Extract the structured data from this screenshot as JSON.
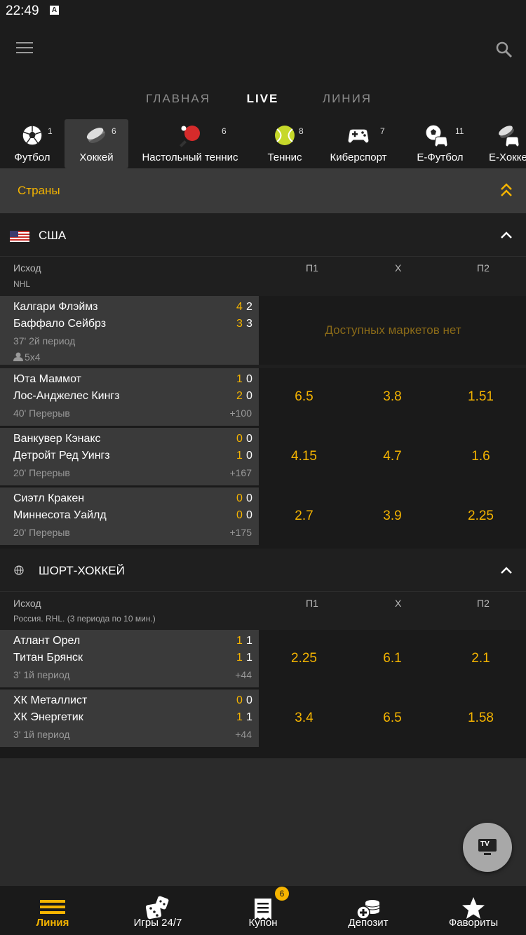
{
  "status": {
    "time": "22:49",
    "icon_letter": "A"
  },
  "tabs": [
    {
      "label": "ГЛАВНАЯ",
      "active": false
    },
    {
      "label": "LIVE",
      "active": true
    },
    {
      "label": "ЛИНИЯ",
      "active": false
    }
  ],
  "sports": [
    {
      "label": "Футбол",
      "count": "1",
      "icon": "soccer-ball-icon"
    },
    {
      "label": "Хоккей",
      "count": "6",
      "icon": "hockey-puck-icon",
      "active": true
    },
    {
      "label": "Настольный теннис",
      "count": "6",
      "icon": "table-tennis-icon"
    },
    {
      "label": "Теннис",
      "count": "8",
      "icon": "tennis-ball-icon"
    },
    {
      "label": "Киберспорт",
      "count": "7",
      "icon": "gamepad-icon"
    },
    {
      "label": "Е-Футбол",
      "count": "11",
      "icon": "e-football-icon"
    },
    {
      "label": "Е-Хоккей",
      "count": "",
      "icon": "e-hockey-icon"
    }
  ],
  "countries_label": "Страны",
  "leagues": [
    {
      "title": "США",
      "columns": {
        "outcome": "Исход",
        "p1": "П1",
        "x": "Х",
        "p2": "П2"
      },
      "sub": "NHL",
      "matches": [
        {
          "team1": "Калгари Флэймз",
          "team2": "Баффало Сейбрз",
          "s1a": "4",
          "s1b": "2",
          "s2a": "3",
          "s2b": "3",
          "period": "37' 2й период",
          "extra": "5x4",
          "no_market": "Доступных маркетов нет"
        },
        {
          "team1": "Юта Маммот",
          "team2": "Лос-Анджелес Кингз",
          "s1a": "1",
          "s1b": "0",
          "s2a": "2",
          "s2b": "0",
          "period": "40' Перерыв",
          "plus": "+100",
          "odds": [
            "6.5",
            "3.8",
            "1.51"
          ]
        },
        {
          "team1": "Ванкувер Кэнакс",
          "team2": "Детройт Ред Уингз",
          "s1a": "0",
          "s1b": "0",
          "s2a": "1",
          "s2b": "0",
          "period": "20' Перерыв",
          "plus": "+167",
          "odds": [
            "4.15",
            "4.7",
            "1.6"
          ]
        },
        {
          "team1": "Сиэтл Кракен",
          "team2": "Миннесота Уайлд",
          "s1a": "0",
          "s1b": "0",
          "s2a": "0",
          "s2b": "0",
          "period": "20' Перерыв",
          "plus": "+175",
          "odds": [
            "2.7",
            "3.9",
            "2.25"
          ]
        }
      ]
    },
    {
      "title": "ШОРТ-ХОККЕЙ",
      "columns": {
        "outcome": "Исход",
        "p1": "П1",
        "x": "Х",
        "p2": "П2"
      },
      "sub": "Россия. RHL. (3 периода по 10 мин.)",
      "matches": [
        {
          "team1": "Атлант Орел",
          "team2": "Титан Брянск",
          "s1a": "1",
          "s1b": "1",
          "s2a": "1",
          "s2b": "1",
          "period": "3' 1й период",
          "plus": "+44",
          "odds": [
            "2.25",
            "6.1",
            "2.1"
          ]
        },
        {
          "team1": "ХК Металлист",
          "team2": "ХК Энергетик",
          "s1a": "0",
          "s1b": "0",
          "s2a": "1",
          "s2b": "1",
          "period": "3' 1й период",
          "plus": "+44",
          "odds": [
            "3.4",
            "6.5",
            "1.58"
          ]
        }
      ]
    }
  ],
  "tv_label": "TV",
  "bottom_nav": [
    {
      "label": "Линия",
      "active": true
    },
    {
      "label": "Игры 24/7"
    },
    {
      "label": "Купон",
      "badge": "6"
    },
    {
      "label": "Депозит"
    },
    {
      "label": "Фавориты"
    }
  ],
  "colors": {
    "accent": "#f5b400",
    "background": "#2b2b2b",
    "panel": "#1c1c1c",
    "card": "#3a3a3a"
  }
}
